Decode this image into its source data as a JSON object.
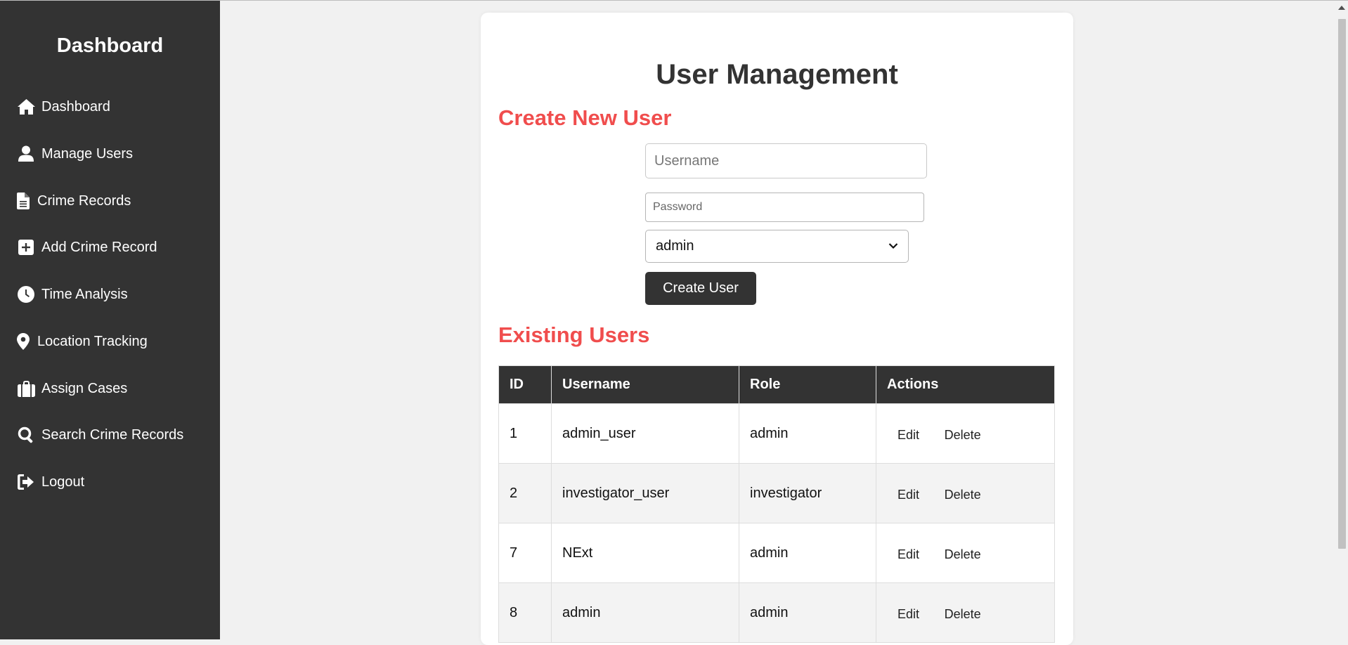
{
  "sidebar": {
    "title": "Dashboard",
    "items": [
      {
        "label": "Dashboard",
        "icon": "home-icon"
      },
      {
        "label": "Manage Users",
        "icon": "user-icon"
      },
      {
        "label": "Crime Records",
        "icon": "file-icon"
      },
      {
        "label": "Add Crime Record",
        "icon": "plus-square-icon"
      },
      {
        "label": "Time Analysis",
        "icon": "clock-icon"
      },
      {
        "label": "Location Tracking",
        "icon": "map-pin-icon"
      },
      {
        "label": "Assign Cases",
        "icon": "briefcase-icon"
      },
      {
        "label": "Search Crime Records",
        "icon": "search-icon"
      },
      {
        "label": "Logout",
        "icon": "logout-icon"
      }
    ]
  },
  "main": {
    "title": "User Management",
    "create_section": {
      "heading": "Create New User",
      "username_placeholder": "Username",
      "password_placeholder": "Password",
      "role_selected": "admin",
      "create_button": "Create User"
    },
    "users_section": {
      "heading": "Existing Users",
      "columns": [
        "ID",
        "Username",
        "Role",
        "Actions"
      ],
      "rows": [
        {
          "id": "1",
          "username": "admin_user",
          "role": "admin"
        },
        {
          "id": "2",
          "username": "investigator_user",
          "role": "investigator"
        },
        {
          "id": "7",
          "username": "NExt",
          "role": "admin"
        },
        {
          "id": "8",
          "username": "admin",
          "role": "admin"
        }
      ],
      "edit_label": "Edit",
      "delete_label": "Delete"
    }
  },
  "colors": {
    "sidebar_bg": "#333333",
    "accent_red": "#f04d4d",
    "page_bg": "#f1f1f1"
  }
}
